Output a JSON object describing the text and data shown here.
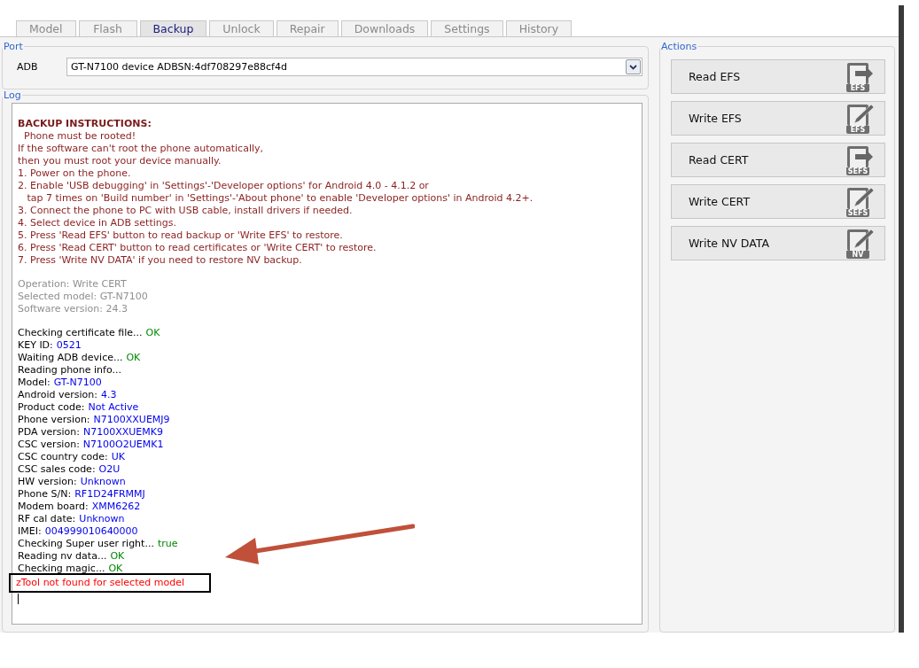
{
  "tabs": [
    {
      "label": "Model",
      "selected": false
    },
    {
      "label": "Flash",
      "selected": false
    },
    {
      "label": "Backup",
      "selected": true
    },
    {
      "label": "Unlock",
      "selected": false
    },
    {
      "label": "Repair",
      "selected": false
    },
    {
      "label": "Downloads",
      "selected": false
    },
    {
      "label": "Settings",
      "selected": false
    },
    {
      "label": "History",
      "selected": false
    }
  ],
  "port": {
    "title": "Port",
    "label": "ADB",
    "value": "GT-N7100 device ADBSN:4df708297e88cf4d"
  },
  "log": {
    "title": "Log",
    "blocks": [
      {
        "lines": [
          {
            "parts": [
              {
                "text": "BACKUP INSTRUCTIONS:",
                "kind": "heading"
              }
            ]
          },
          {
            "parts": [
              {
                "text": "  Phone must be rooted!",
                "kind": "instruction"
              }
            ]
          },
          {
            "parts": [
              {
                "text": "If the software can't root the phone automatically,",
                "kind": "instruction"
              }
            ]
          },
          {
            "parts": [
              {
                "text": "then you must root your device manually.",
                "kind": "instruction"
              }
            ]
          },
          {
            "parts": [
              {
                "text": "1. Power on the phone.",
                "kind": "instruction"
              }
            ]
          },
          {
            "parts": [
              {
                "text": "2. Enable 'USB debugging' in 'Settings'-'Developer options' for Android 4.0 - 4.1.2 or",
                "kind": "instruction"
              }
            ]
          },
          {
            "parts": [
              {
                "text": "   tap 7 times on 'Build number' in 'Settings'-'About phone' to enable 'Developer options' in Android 4.2+.",
                "kind": "instruction"
              }
            ]
          },
          {
            "parts": [
              {
                "text": "3. Connect the phone to PC with USB cable, install drivers if needed.",
                "kind": "instruction"
              }
            ]
          },
          {
            "parts": [
              {
                "text": "4. Select device in ADB settings.",
                "kind": "instruction"
              }
            ]
          },
          {
            "parts": [
              {
                "text": "5. Press 'Read EFS' button to read backup or 'Write EFS' to restore.",
                "kind": "instruction"
              }
            ]
          },
          {
            "parts": [
              {
                "text": "6. Press 'Read CERT' button to read certificates or 'Write CERT' to restore.",
                "kind": "instruction"
              }
            ]
          },
          {
            "parts": [
              {
                "text": "7. Press 'Write NV DATA' if you need to restore NV backup.",
                "kind": "instruction"
              }
            ]
          }
        ]
      },
      {
        "lines": [
          {
            "parts": [
              {
                "text": "Operation: Write CERT",
                "kind": "info"
              }
            ]
          },
          {
            "parts": [
              {
                "text": "Selected model: GT-N7100",
                "kind": "info"
              }
            ]
          },
          {
            "parts": [
              {
                "text": "Software version: 24.3",
                "kind": "info"
              }
            ]
          }
        ]
      },
      {
        "lines": [
          {
            "parts": [
              {
                "text": "Checking certificate file...",
                "kind": "text"
              },
              {
                "text": "OK",
                "kind": "ok"
              }
            ]
          },
          {
            "parts": [
              {
                "text": "KEY ID:",
                "kind": "text"
              },
              {
                "text": "0521",
                "kind": "value"
              }
            ]
          },
          {
            "parts": [
              {
                "text": "Waiting ADB device...",
                "kind": "text"
              },
              {
                "text": "OK",
                "kind": "ok"
              }
            ]
          },
          {
            "parts": [
              {
                "text": "Reading phone info...",
                "kind": "text"
              }
            ]
          },
          {
            "parts": [
              {
                "text": "Model:",
                "kind": "text"
              },
              {
                "text": "GT-N7100",
                "kind": "value"
              }
            ]
          },
          {
            "parts": [
              {
                "text": "Android version:",
                "kind": "text"
              },
              {
                "text": "4.3",
                "kind": "value"
              }
            ]
          },
          {
            "parts": [
              {
                "text": "Product code:",
                "kind": "text"
              },
              {
                "text": "Not Active",
                "kind": "value"
              }
            ]
          },
          {
            "parts": [
              {
                "text": "Phone version:",
                "kind": "text"
              },
              {
                "text": "N7100XXUEMJ9",
                "kind": "value"
              }
            ]
          },
          {
            "parts": [
              {
                "text": "PDA version:",
                "kind": "text"
              },
              {
                "text": "N7100XXUEMK9",
                "kind": "value"
              }
            ]
          },
          {
            "parts": [
              {
                "text": "CSC version:",
                "kind": "text"
              },
              {
                "text": "N7100O2UEMK1",
                "kind": "value"
              }
            ]
          },
          {
            "parts": [
              {
                "text": "CSC country code:",
                "kind": "text"
              },
              {
                "text": "UK",
                "kind": "value"
              }
            ]
          },
          {
            "parts": [
              {
                "text": "CSC sales code:",
                "kind": "text"
              },
              {
                "text": "O2U",
                "kind": "value"
              }
            ]
          },
          {
            "parts": [
              {
                "text": "HW version:",
                "kind": "text"
              },
              {
                "text": "Unknown",
                "kind": "value"
              }
            ]
          },
          {
            "parts": [
              {
                "text": "Phone S/N:",
                "kind": "text"
              },
              {
                "text": "RF1D24FRMMJ",
                "kind": "value"
              }
            ]
          },
          {
            "parts": [
              {
                "text": "Modem board:",
                "kind": "text"
              },
              {
                "text": "XMM6262",
                "kind": "value"
              }
            ]
          },
          {
            "parts": [
              {
                "text": "RF cal date:",
                "kind": "text"
              },
              {
                "text": "Unknown",
                "kind": "value"
              }
            ]
          },
          {
            "parts": [
              {
                "text": "IMEI:",
                "kind": "text"
              },
              {
                "text": "004999010640000",
                "kind": "value"
              }
            ]
          },
          {
            "parts": [
              {
                "text": "Checking Super user right...",
                "kind": "text"
              },
              {
                "text": "true",
                "kind": "ok"
              }
            ]
          },
          {
            "parts": [
              {
                "text": "Reading nv data...",
                "kind": "text"
              },
              {
                "text": "OK",
                "kind": "ok"
              }
            ]
          },
          {
            "parts": [
              {
                "text": "Checking magic...",
                "kind": "text"
              },
              {
                "text": "OK",
                "kind": "ok"
              }
            ]
          },
          {
            "parts": [
              {
                "text": "zTool not found for selected model",
                "kind": "error"
              }
            ],
            "highlighted": true
          }
        ]
      }
    ]
  },
  "actions": {
    "title": "Actions",
    "buttons": [
      {
        "label": "Read EFS",
        "kind": "read",
        "icon_label": "EFS"
      },
      {
        "label": "Write EFS",
        "kind": "write",
        "icon_label": "EFS"
      },
      {
        "label": "Read CERT",
        "kind": "read",
        "icon_label": "SEFS"
      },
      {
        "label": "Write CERT",
        "kind": "write",
        "icon_label": "SEFS"
      },
      {
        "label": "Write NV DATA",
        "kind": "write",
        "icon_label": "NV"
      }
    ]
  }
}
